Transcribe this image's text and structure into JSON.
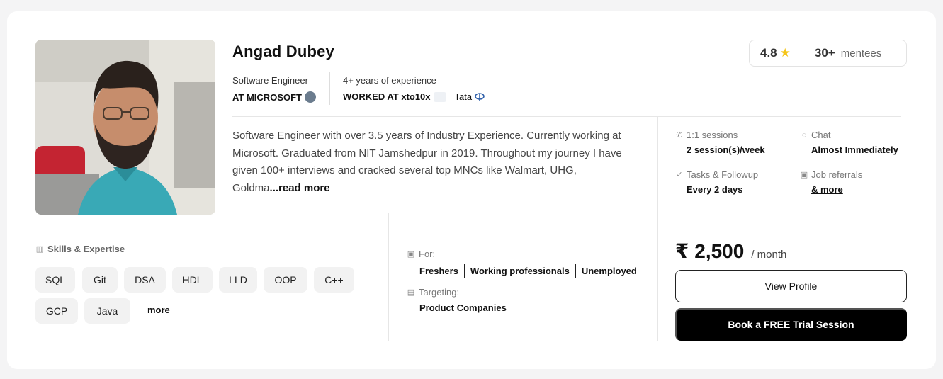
{
  "mentor": {
    "name": "Angad Dubey",
    "role": "Software Engineer",
    "company": "AT MICROSOFT",
    "experience": "4+ years of experience",
    "worked_at_label": "WORKED AT xto10x",
    "worked_at_other": "Tata",
    "bio": "Software Engineer with over 3.5 years of Industry Experience. Currently working at Microsoft. Graduated from NIT Jamshedpur in 2019. Throughout my journey I have given 100+ interviews and cracked several top MNCs like Walmart, UHG, Goldma",
    "read_more": "...read more"
  },
  "stats": {
    "rating": "4.8",
    "mentees_count": "30+",
    "mentees_label": "mentees",
    "star_color": "#f5c518"
  },
  "features": {
    "sessions_label": "1:1 sessions",
    "sessions_value": "2 session(s)/week",
    "chat_label": "Chat",
    "chat_value": "Almost Immediately",
    "tasks_label": "Tasks & Followup",
    "tasks_value": "Every 2 days",
    "referrals_label": "Job referrals",
    "referrals_value": "& more"
  },
  "skills": {
    "title": "Skills & Expertise",
    "items": [
      "SQL",
      "Git",
      "DSA",
      "HDL",
      "LLD",
      "OOP",
      "C++",
      "GCP",
      "Java"
    ],
    "more": "more"
  },
  "audience": {
    "for_label": "For:",
    "for_items": [
      "Freshers",
      "Working professionals",
      "Unemployed"
    ],
    "targeting_label": "Targeting:",
    "targeting_value": "Product Companies"
  },
  "pricing": {
    "amount": "₹ 2,500",
    "period": "/ month",
    "view_profile": "View Profile",
    "book_trial": "Book a FREE Trial Session"
  }
}
